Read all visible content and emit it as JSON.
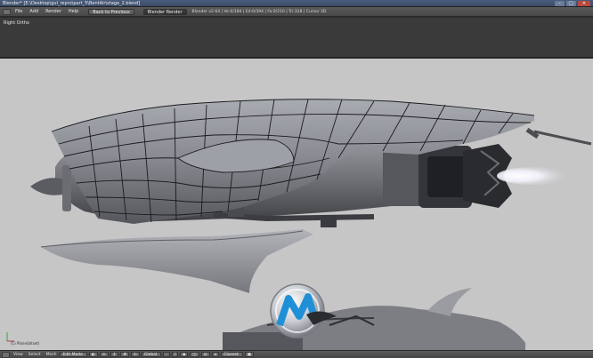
{
  "window": {
    "title": "Blender* [E:\\Desktop\\gul_repro\\part_5\\BentAir\\stage_2.blend]",
    "buttons": {
      "minimize": "–",
      "maximize": "□",
      "close": "✕"
    }
  },
  "menubar": {
    "items": [
      "File",
      "Add",
      "Render",
      "Help"
    ],
    "back_button": "Back to Previous",
    "render_engine": "Blender Render",
    "stats": "Blender v2.64 | Ve:0/184 | Ed:0/394 | Fa:0/210 | Tri:328 | Cursor 3D"
  },
  "viewport": {
    "view_label": "Right Ortho",
    "object_label": "(1) Plane(bitset)"
  },
  "footer": {
    "items": [
      "View",
      "Select",
      "Mesh"
    ],
    "mode": "Edit Mode",
    "orientation": "Global",
    "pivot": "Closest"
  },
  "colors": {
    "viewport_bg": "#c6c6c6",
    "header_bg": "#4b4b4b",
    "toolband_bg": "#3a3a3a",
    "ship_metal": "#8d8f96",
    "logo_blue": "#1f8fd6"
  }
}
